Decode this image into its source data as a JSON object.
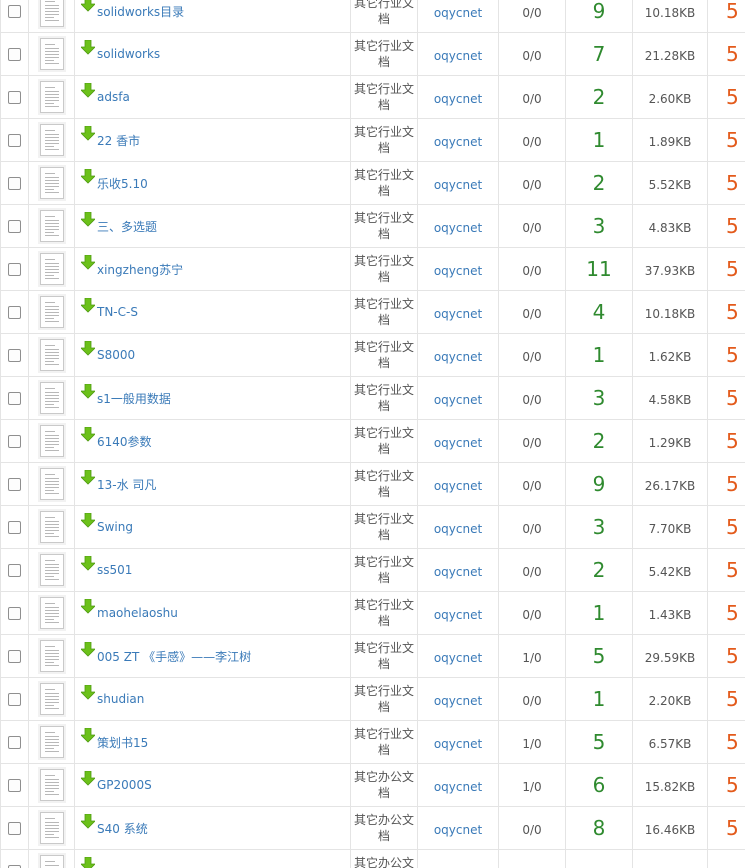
{
  "table": {
    "rows": [
      {
        "title": "solidworks目录",
        "category": "其它行业文档",
        "user": "oqycnet",
        "vote": "0/0",
        "pages": "9",
        "size": "10.18KB",
        "price": "5"
      },
      {
        "title": "solidworks",
        "category": "其它行业文档",
        "user": "oqycnet",
        "vote": "0/0",
        "pages": "7",
        "size": "21.28KB",
        "price": "5"
      },
      {
        "title": "adsfa",
        "category": "其它行业文档",
        "user": "oqycnet",
        "vote": "0/0",
        "pages": "2",
        "size": "2.60KB",
        "price": "5"
      },
      {
        "title": "22 香市",
        "category": "其它行业文档",
        "user": "oqycnet",
        "vote": "0/0",
        "pages": "1",
        "size": "1.89KB",
        "price": "5"
      },
      {
        "title": "乐收5.10",
        "category": "其它行业文档",
        "user": "oqycnet",
        "vote": "0/0",
        "pages": "2",
        "size": "5.52KB",
        "price": "5"
      },
      {
        "title": "三、多选题",
        "category": "其它行业文档",
        "user": "oqycnet",
        "vote": "0/0",
        "pages": "3",
        "size": "4.83KB",
        "price": "5"
      },
      {
        "title": "xingzheng苏宁",
        "category": "其它行业文档",
        "user": "oqycnet",
        "vote": "0/0",
        "pages": "11",
        "size": "37.93KB",
        "price": "5"
      },
      {
        "title": "TN-C-S",
        "category": "其它行业文档",
        "user": "oqycnet",
        "vote": "0/0",
        "pages": "4",
        "size": "10.18KB",
        "price": "5"
      },
      {
        "title": "S8000",
        "category": "其它行业文档",
        "user": "oqycnet",
        "vote": "0/0",
        "pages": "1",
        "size": "1.62KB",
        "price": "5"
      },
      {
        "title": "s1一般用数据",
        "category": "其它行业文档",
        "user": "oqycnet",
        "vote": "0/0",
        "pages": "3",
        "size": "4.58KB",
        "price": "5"
      },
      {
        "title": "6140参数",
        "category": "其它行业文档",
        "user": "oqycnet",
        "vote": "0/0",
        "pages": "2",
        "size": "1.29KB",
        "price": "5"
      },
      {
        "title": "13-水 司凡",
        "category": "其它行业文档",
        "user": "oqycnet",
        "vote": "0/0",
        "pages": "9",
        "size": "26.17KB",
        "price": "5"
      },
      {
        "title": "Swing",
        "category": "其它行业文档",
        "user": "oqycnet",
        "vote": "0/0",
        "pages": "3",
        "size": "7.70KB",
        "price": "5"
      },
      {
        "title": "ss501",
        "category": "其它行业文档",
        "user": "oqycnet",
        "vote": "0/0",
        "pages": "2",
        "size": "5.42KB",
        "price": "5"
      },
      {
        "title": "maohelaoshu",
        "category": "其它行业文档",
        "user": "oqycnet",
        "vote": "0/0",
        "pages": "1",
        "size": "1.43KB",
        "price": "5"
      },
      {
        "title": "005 ZT 《手感》——李江树",
        "category": "其它行业文档",
        "user": "oqycnet",
        "vote": "1/0",
        "pages": "5",
        "size": "29.59KB",
        "price": "5"
      },
      {
        "title": "shudian",
        "category": "其它行业文档",
        "user": "oqycnet",
        "vote": "0/0",
        "pages": "1",
        "size": "2.20KB",
        "price": "5"
      },
      {
        "title": "策划书15",
        "category": "其它行业文档",
        "user": "oqycnet",
        "vote": "1/0",
        "pages": "5",
        "size": "6.57KB",
        "price": "5"
      },
      {
        "title": "GP2000S",
        "category": "其它办公文档",
        "user": "oqycnet",
        "vote": "1/0",
        "pages": "6",
        "size": "15.82KB",
        "price": "5"
      },
      {
        "title": "S40 系统",
        "category": "其它办公文档",
        "user": "oqycnet",
        "vote": "0/0",
        "pages": "8",
        "size": "16.46KB",
        "price": "5"
      },
      {
        "title": "",
        "category": "其它办公文档",
        "user": "",
        "vote": "",
        "pages": "",
        "size": "",
        "price": ""
      }
    ]
  },
  "colors": {
    "link": "#3a7ab8",
    "pages": "#2f8a2f",
    "price": "#e35a1b",
    "download_icon": "#6cc11a"
  },
  "icons": {
    "row_download": "download-arrow-icon",
    "row_thumbnail": "document-thumbnail-icon"
  }
}
